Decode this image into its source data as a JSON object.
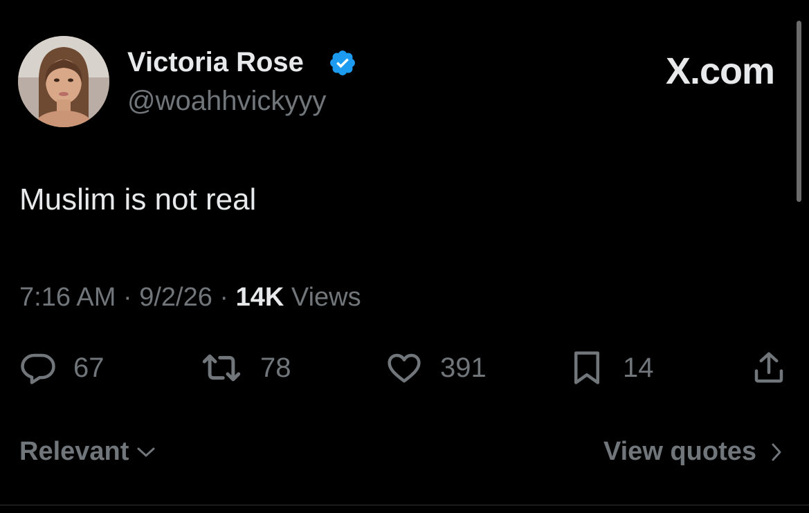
{
  "author": {
    "name": "Victoria Rose",
    "handle": "@woahhvickyyy",
    "verified": true,
    "verified_color": "#1d9bf0"
  },
  "watermark": "X.com",
  "tweet": {
    "text": "Muslim is not real",
    "time": "7:16 AM",
    "date": "9/2/26",
    "separator": "·",
    "views_count": "14K",
    "views_label": "Views"
  },
  "actions": {
    "replies": {
      "icon": "reply-icon",
      "count": "67"
    },
    "reposts": {
      "icon": "repost-icon",
      "count": "78"
    },
    "likes": {
      "icon": "heart-icon",
      "count": "391"
    },
    "bookmarks": {
      "icon": "bookmark-icon",
      "count": "14"
    },
    "share": {
      "icon": "share-icon"
    }
  },
  "footer": {
    "sort_label": "Relevant",
    "view_quotes_label": "View quotes"
  },
  "colors": {
    "background": "#000000",
    "primary_text": "#e7e9ea",
    "secondary_text": "#71767b"
  }
}
